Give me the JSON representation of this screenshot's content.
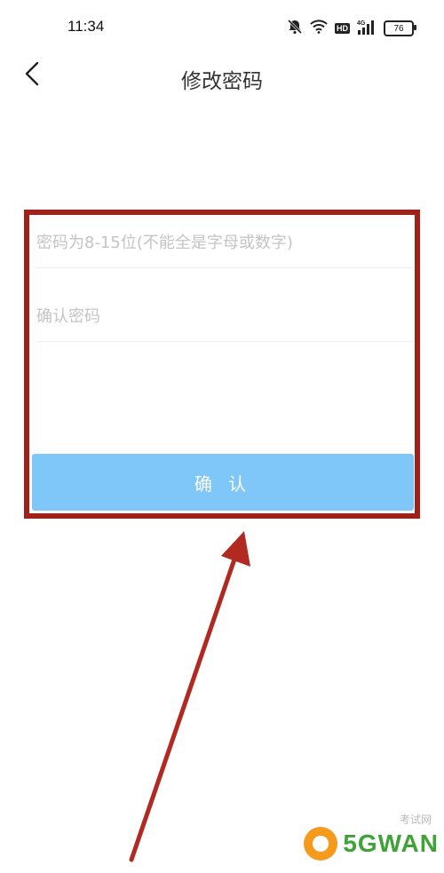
{
  "status_bar": {
    "time": "11:34",
    "battery": "76",
    "icons": [
      "bell-muted-icon",
      "wifi-icon",
      "hd-icon",
      "signal-4g-icon",
      "battery-icon"
    ],
    "hd_label": "HD"
  },
  "nav": {
    "title": "修改密码",
    "back_icon": "chevron-left-icon"
  },
  "form": {
    "password_placeholder": "密码为8-15位(不能全是字母或数字)",
    "password_value": "",
    "confirm_placeholder": "确认密码",
    "confirm_value": "",
    "submit_label": "确 认"
  },
  "annotation": {
    "highlight_color": "#a0201a",
    "arrow_color": "#b02a22"
  },
  "watermark": {
    "brand": "5GWAN",
    "small_text": "考试网"
  },
  "colors": {
    "button": "#7fc7f8",
    "placeholder": "#c4c4c4",
    "accent_green": "#3fa33a",
    "accent_orange": "#f59a1b"
  }
}
